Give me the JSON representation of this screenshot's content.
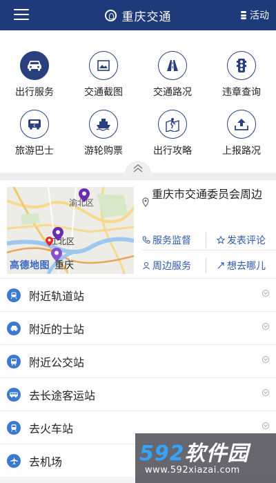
{
  "header": {
    "title": "重庆交通",
    "activity_label": "活动"
  },
  "grid": [
    {
      "label": "出行服务",
      "icon": "car-icon"
    },
    {
      "label": "交通截图",
      "icon": "picture-icon"
    },
    {
      "label": "交通路况",
      "icon": "road-icon"
    },
    {
      "label": "违章查询",
      "icon": "traffic-light-icon"
    },
    {
      "label": "旅游巴士",
      "icon": "bus-icon"
    },
    {
      "label": "游轮购票",
      "icon": "ship-icon"
    },
    {
      "label": "出行攻略",
      "icon": "guide-icon"
    },
    {
      "label": "上报路况",
      "icon": "upload-icon"
    }
  ],
  "map": {
    "district_top": "渝北区",
    "district_mid": "江北区",
    "logo_text": "高德地图",
    "city": "重庆",
    "place": "重庆市交通委员会周边",
    "services": [
      "服务监督",
      "发表评论",
      "周边服务",
      "想去哪儿"
    ]
  },
  "list": [
    {
      "label": "附近轨道站",
      "icon": "metro-icon"
    },
    {
      "label": "附近的士站",
      "icon": "taxi-icon"
    },
    {
      "label": "附近公交站",
      "icon": "bus-stop-icon"
    },
    {
      "label": "去长途客运站",
      "icon": "coach-icon"
    },
    {
      "label": "去火车站",
      "icon": "train-icon"
    },
    {
      "label": "去机场",
      "icon": "plane-icon"
    }
  ],
  "watermark": {
    "brand_num": "592",
    "brand_text": "软件园",
    "url": "www.592xiazai.com"
  },
  "colors": {
    "header": "#1f3a7a",
    "accent": "#2a3f7e",
    "link": "#2f5aa8",
    "list_icon": "#3b78d0"
  }
}
